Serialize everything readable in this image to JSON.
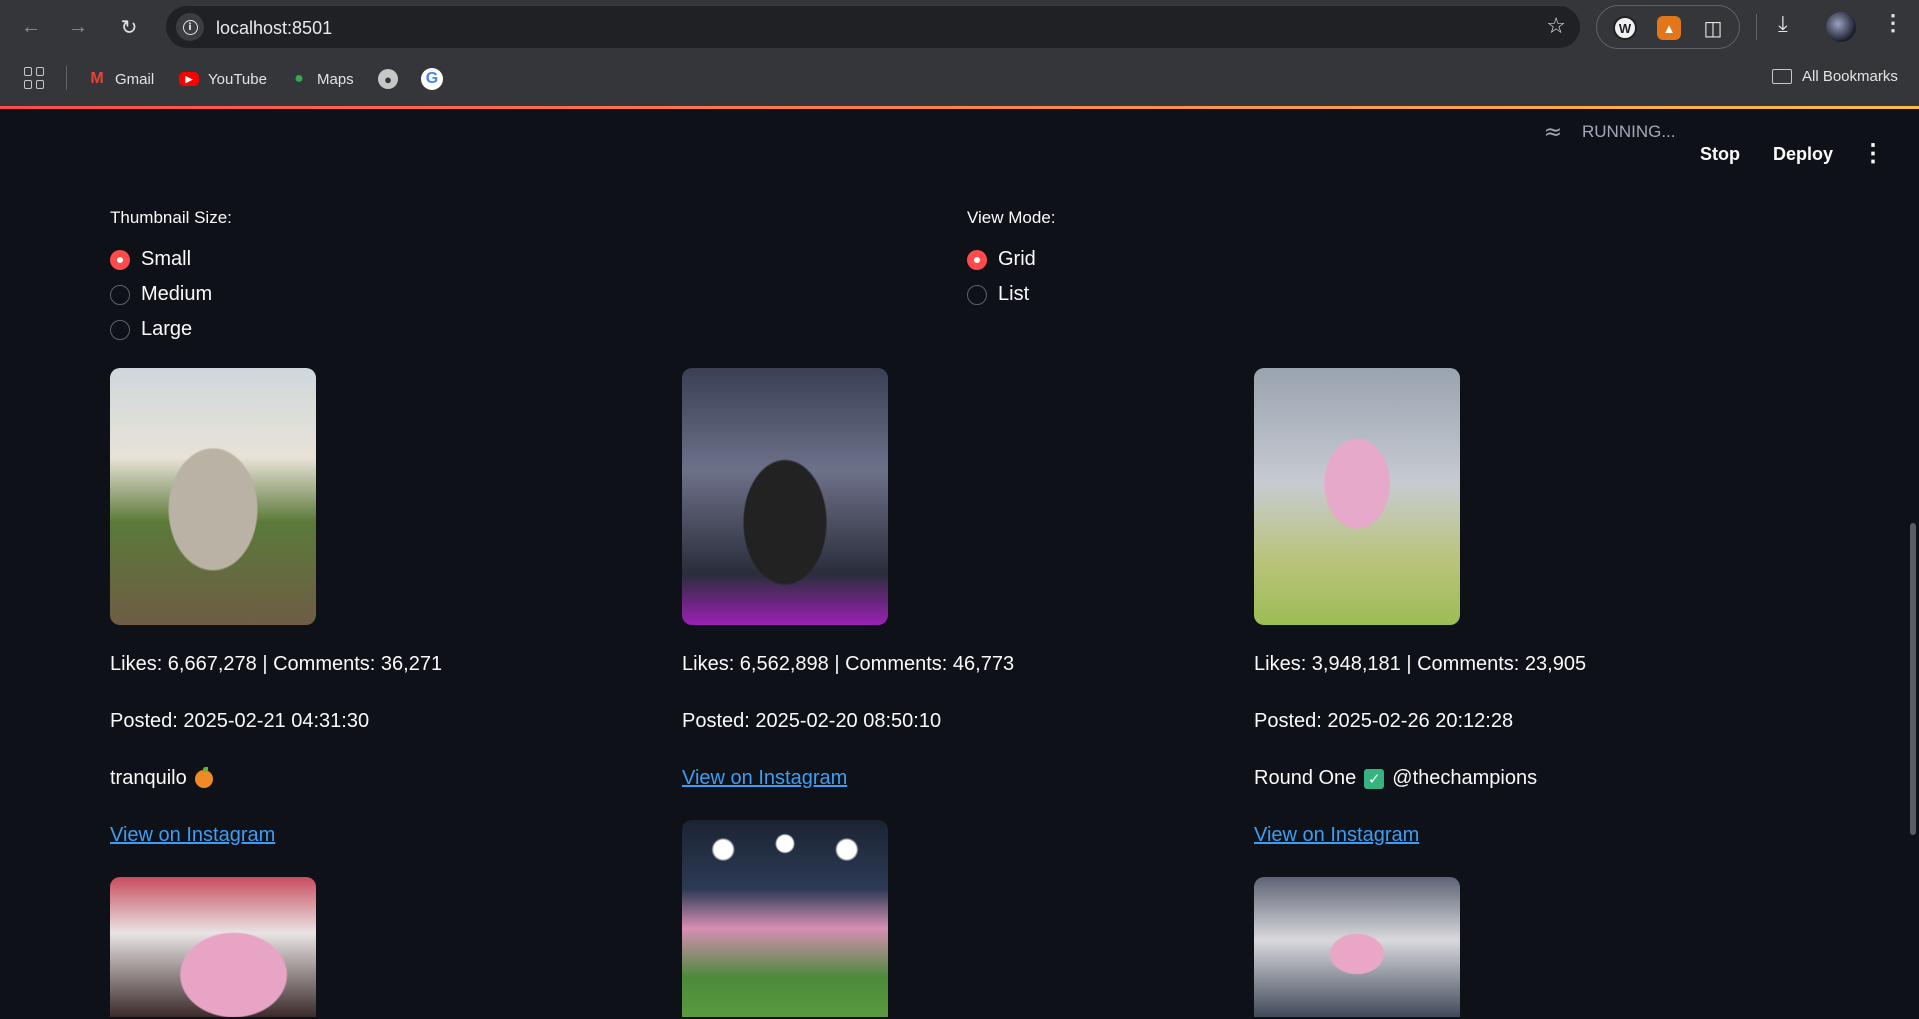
{
  "browser": {
    "url": "localhost:8501",
    "bookmarks": [
      {
        "label": "Gmail",
        "icon": "gmail-icon"
      },
      {
        "label": "YouTube",
        "icon": "youtube-icon"
      },
      {
        "label": "Maps",
        "icon": "maps-icon"
      },
      {
        "label": "",
        "icon": "globe-icon"
      },
      {
        "label": "",
        "icon": "google-icon"
      }
    ],
    "all_bookmarks": "All Bookmarks"
  },
  "app": {
    "status": "RUNNING...",
    "stop": "Stop",
    "deploy": "Deploy",
    "thumbnail_size": {
      "label": "Thumbnail Size:",
      "options": [
        "Small",
        "Medium",
        "Large"
      ],
      "selected": "Small"
    },
    "view_mode": {
      "label": "View Mode:",
      "options": [
        "Grid",
        "List"
      ],
      "selected": "Grid"
    },
    "posts": [
      {
        "stats": "Likes: 6,667,278 | Comments: 36,271",
        "posted": "Posted: 2025-02-21 04:31:30",
        "caption": "tranquilo",
        "caption_emoji": "orange",
        "link": "View on Instagram"
      },
      {
        "stats": "Likes: 6,562,898 | Comments: 46,773",
        "posted": "Posted: 2025-02-20 08:50:10",
        "caption": "",
        "link": "View on Instagram"
      },
      {
        "stats": "Likes: 3,948,181 | Comments: 23,905",
        "posted": "Posted: 2025-02-26 20:12:28",
        "caption_pre": "Round One",
        "caption_post": "@thechampions",
        "caption_emoji": "check",
        "link": "View on Instagram"
      }
    ],
    "colors": {
      "accent": "#ff4b4b",
      "link": "#3d9df3",
      "background": "#0e1117"
    }
  }
}
